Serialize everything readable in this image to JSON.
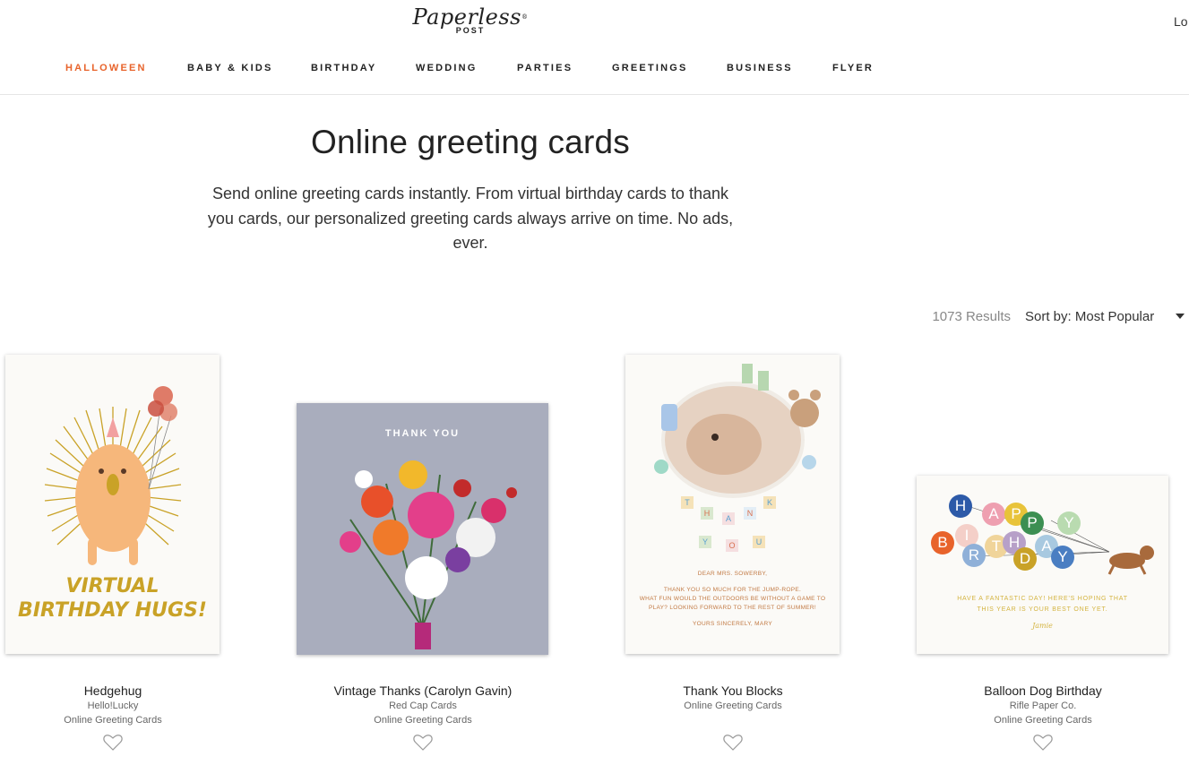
{
  "brand": {
    "logo_script": "Paperless",
    "logo_sub": "POST",
    "logo_mark": "®"
  },
  "header": {
    "login_label": "Lo"
  },
  "nav": {
    "items": [
      {
        "label": "HALLOWEEN",
        "active": true
      },
      {
        "label": "BABY & KIDS",
        "active": false
      },
      {
        "label": "BIRTHDAY",
        "active": false
      },
      {
        "label": "WEDDING",
        "active": false
      },
      {
        "label": "PARTIES",
        "active": false
      },
      {
        "label": "GREETINGS",
        "active": false
      },
      {
        "label": "BUSINESS",
        "active": false
      },
      {
        "label": "FLYER",
        "active": false
      }
    ]
  },
  "hero": {
    "title": "Online greeting cards",
    "description": "Send online greeting cards instantly. From virtual birthday cards to thank you cards, our personalized greeting cards always arrive on time. No ads, ever."
  },
  "results": {
    "count_label": "1073 Results",
    "sort_label": "Sort by: Most Popular"
  },
  "cards": [
    {
      "title": "Hedgehug",
      "brand": "Hello!Lucky",
      "category": "Online Greeting Cards",
      "art_text_1": "VIRTUAL",
      "art_text_2": "BIRTHDAY HUGS!"
    },
    {
      "title": "Vintage Thanks (Carolyn Gavin)",
      "brand": "Red Cap Cards",
      "category": "Online Greeting Cards",
      "art_text_1": "THANK YOU"
    },
    {
      "title": "Thank You Blocks",
      "brand": "",
      "category": "Online Greeting Cards",
      "blocks_top": [
        "T",
        "H",
        "A",
        "N",
        "K"
      ],
      "blocks_bottom": [
        "Y",
        "O",
        "U"
      ],
      "art_greeting": "DEAR MRS. SOWERBY,",
      "art_body_1": "THANK YOU SO MUCH FOR THE JUMP-ROPE.",
      "art_body_2": "WHAT FUN WOULD THE OUTDOORS BE WITHOUT A GAME TO",
      "art_body_3": "PLAY? LOOKING FORWARD TO THE REST OF SUMMER!",
      "art_sign": "YOURS SINCERELY, MARY"
    },
    {
      "title": "Balloon Dog Birthday",
      "brand": "Rifle Paper Co.",
      "category": "Online Greeting Cards",
      "balloons": [
        "H",
        "A",
        "P",
        "P",
        "Y",
        "B",
        "I",
        "R",
        "T",
        "H",
        "D",
        "A",
        "Y"
      ],
      "art_body_1": "HAVE A FANTASTIC DAY! HERE'S HOPING THAT",
      "art_body_2": "THIS YEAR IS YOUR BEST ONE YET.",
      "art_sign": "Jamie"
    }
  ],
  "colors": {
    "accent": "#e8632b",
    "gold": "#c9a227"
  }
}
